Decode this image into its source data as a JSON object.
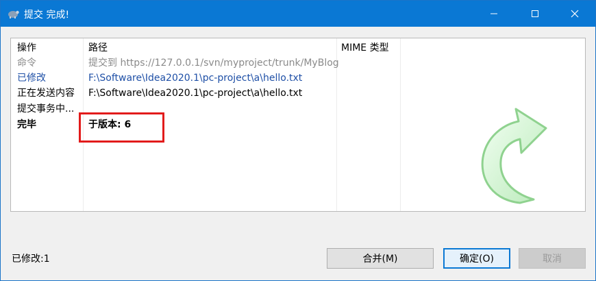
{
  "window": {
    "title": "提交 完成!"
  },
  "columns": {
    "action": "操作",
    "path": "路径",
    "mime": "MIME 类型"
  },
  "rows": [
    {
      "action": "命令",
      "path": "提交到 https://127.0.0.1/svn/myproject/trunk/MyBlog",
      "style": "gray"
    },
    {
      "action": "已修改",
      "path": "F:\\Software\\Idea2020.1\\pc-project\\a\\hello.txt",
      "style": "blue"
    },
    {
      "action": "正在发送内容",
      "path": "F:\\Software\\Idea2020.1\\pc-project\\a\\hello.txt",
      "style": "normal"
    },
    {
      "action": "提交事务中...",
      "path": "",
      "style": "normal"
    },
    {
      "action": "完毕",
      "path": "于版本: 6",
      "style": "bold"
    }
  ],
  "status": {
    "text": "已修改:1"
  },
  "buttons": {
    "merge": "合并(M)",
    "ok": "确定(O)",
    "cancel": "取消"
  },
  "colors": {
    "titlebar": "#0a78d4",
    "highlight": "#e21b1b",
    "modified_text": "#1e4fa6"
  }
}
